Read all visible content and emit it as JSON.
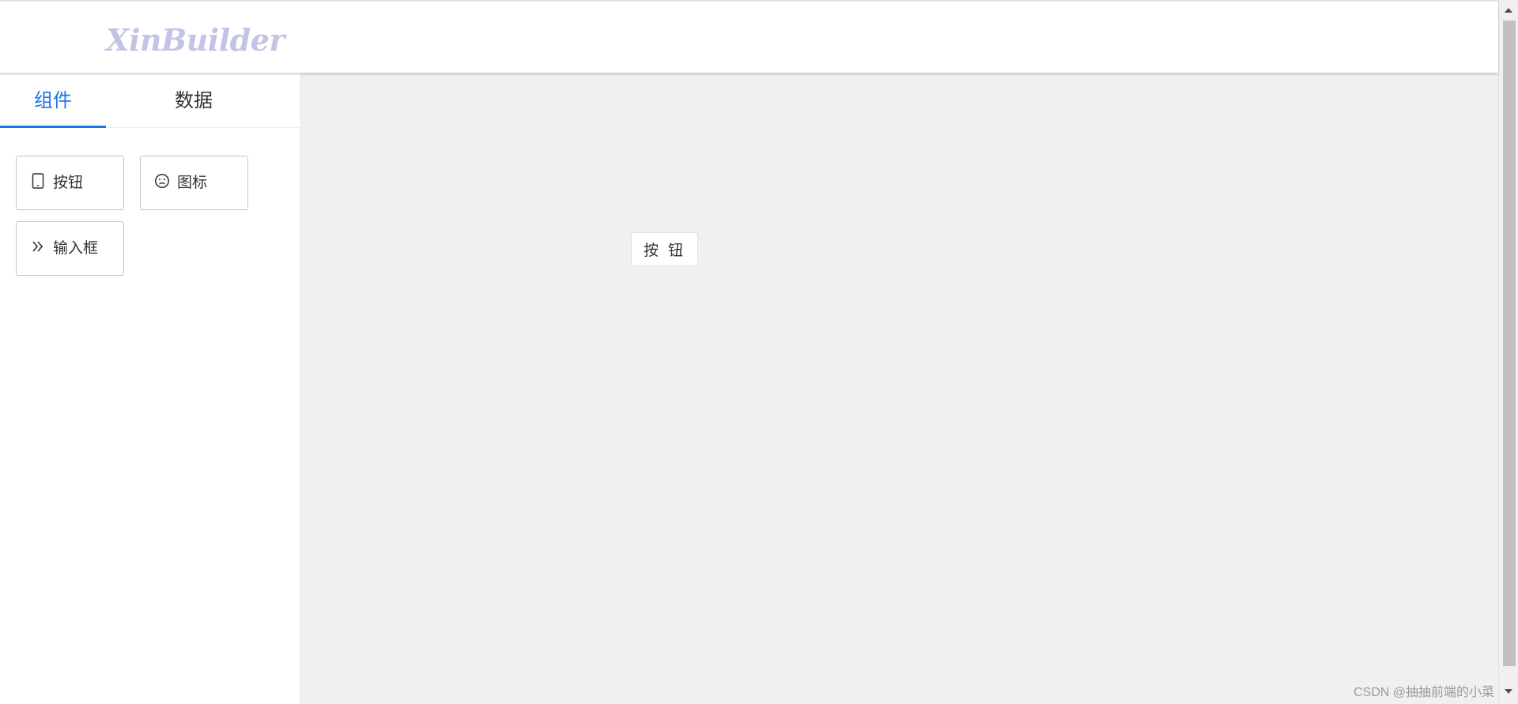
{
  "header": {
    "logo_text": "XinBuilder",
    "logo_color": "#c3c3e6"
  },
  "sidebar": {
    "tabs": [
      {
        "label": "组件",
        "active": true,
        "icon": null
      },
      {
        "label": "数据",
        "active": false,
        "icon": null
      }
    ],
    "active_color": "#1a73e8",
    "components": [
      {
        "label": "按钮",
        "icon": "mobile-device-icon"
      },
      {
        "label": "图标",
        "icon": "sad-face-icon"
      },
      {
        "label": "输入框",
        "icon": "double-chevron-right-icon"
      }
    ]
  },
  "canvas": {
    "background": "#f0f0f0",
    "button_label": "按 钮"
  },
  "watermark": {
    "text": "CSDN @抽抽前端的小菜"
  }
}
